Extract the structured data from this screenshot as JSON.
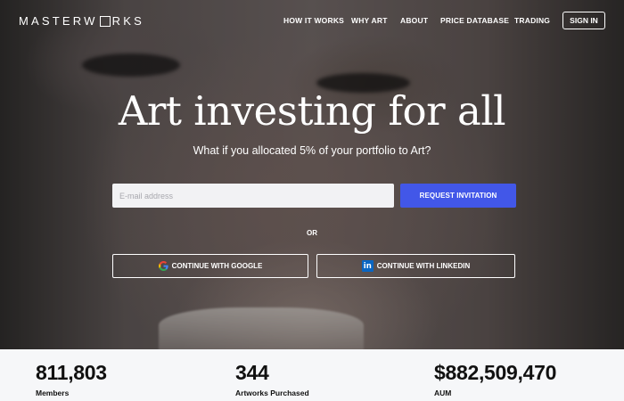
{
  "brand": {
    "logo_text_pre": "MASTERW",
    "logo_text_post": "RKS"
  },
  "nav": {
    "items": [
      {
        "label": "HOW IT WORKS"
      },
      {
        "label": "WHY ART"
      },
      {
        "label": "ABOUT"
      },
      {
        "label": "PRICE DATABASE"
      },
      {
        "label": "TRADING"
      }
    ],
    "signin_label": "SIGN IN"
  },
  "hero": {
    "title": "Art investing for all",
    "subtitle": "What if you allocated 5% of your portfolio to Art?",
    "email_placeholder": "E-mail address",
    "email_value": "",
    "request_label": "REQUEST INVITATION",
    "or_label": "OR",
    "google_label": "CONTINUE WITH GOOGLE",
    "linkedin_label": "CONTINUE WITH LINKEDIN"
  },
  "stats": [
    {
      "value": "811,803",
      "label": "Members"
    },
    {
      "value": "344",
      "label": "Artworks Purchased"
    },
    {
      "value": "$882,509,470",
      "label": "AUM"
    }
  ],
  "colors": {
    "accent": "#4257e8",
    "linkedin": "#0a66c2"
  },
  "icons": {
    "google": "google-icon",
    "linkedin": "linkedin-icon"
  }
}
